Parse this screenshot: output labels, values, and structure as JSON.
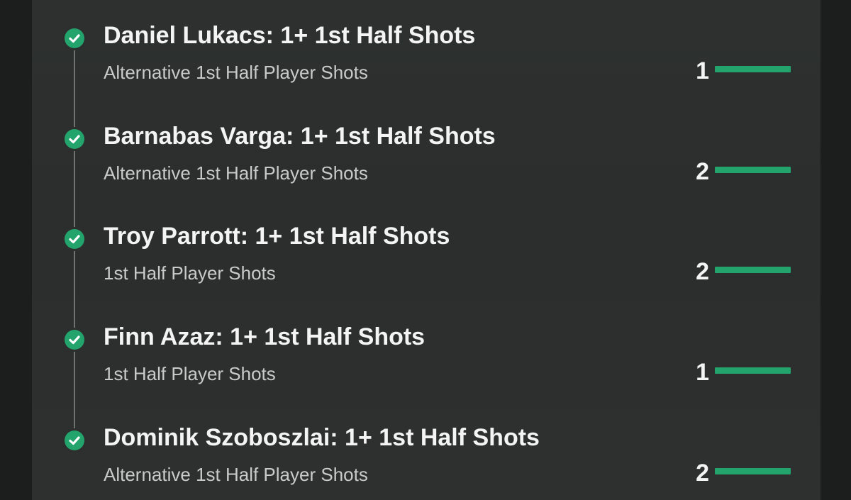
{
  "legs": [
    {
      "title": "Daniel Lukacs: 1+ 1st Half Shots",
      "market": "Alternative 1st Half Player Shots",
      "value": "1",
      "progress": 1.0,
      "status": "won"
    },
    {
      "title": "Barnabas Varga: 1+ 1st Half Shots",
      "market": "Alternative 1st Half Player Shots",
      "value": "2",
      "progress": 1.0,
      "status": "won"
    },
    {
      "title": "Troy Parrott: 1+ 1st Half Shots",
      "market": "1st Half Player Shots",
      "value": "2",
      "progress": 1.0,
      "status": "won"
    },
    {
      "title": "Finn Azaz: 1+ 1st Half Shots",
      "market": "1st Half Player Shots",
      "value": "1",
      "progress": 1.0,
      "status": "won"
    },
    {
      "title": "Dominik Szoboszlai: 1+ 1st Half Shots",
      "market": "Alternative 1st Half Player Shots",
      "value": "2",
      "progress": 1.0,
      "status": "won"
    }
  ],
  "icons": {
    "status": "check-circle-icon"
  },
  "colors": {
    "accent": "#23a46d",
    "background": "#2c2f2e",
    "text": "#f4f4f4",
    "subtext": "#c9cbca"
  }
}
